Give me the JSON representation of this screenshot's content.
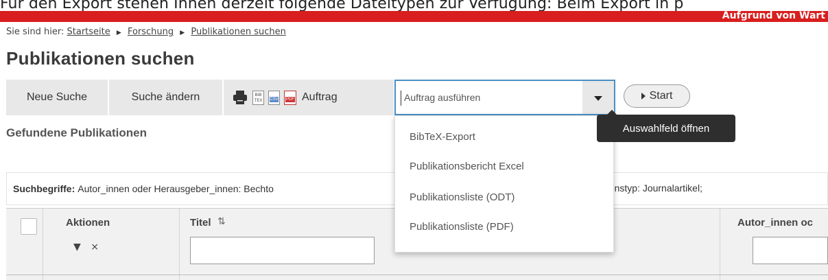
{
  "top_caption": "Für den Export stehen Ihnen derzeit folgende Dateitypen zur Verfügung: Beim Export in p",
  "redbar": {
    "text": "Aufgrund von Wart",
    "color": "#d81e1e"
  },
  "breadcrumb": {
    "prefix": "Sie sind hier:",
    "items": [
      "Startseite",
      "Forschung",
      "Publikationen suchen"
    ]
  },
  "page_title": "Publikationen suchen",
  "toolbar": {
    "new_search": "Neue Suche",
    "edit_search": "Suche ändern",
    "icons": [
      "print-icon",
      "bibtex-icon",
      "csv-icon",
      "pdf-icon"
    ],
    "icon_texts": {
      "bibtex": "BIB TEX",
      "csv": "CSV",
      "pdf": "PDF"
    },
    "auftrag_label": "Auftrag",
    "select_value": "Auftrag ausführen",
    "start_label": "Start"
  },
  "section_heading": "Gefundene Publikationen",
  "search_terms": {
    "label": "Suchbegriffe:",
    "text_left": "Autor_innen oder Herausgeber_innen: Bechto",
    "text_right": "ationstyp: Journalartikel;"
  },
  "table": {
    "headers": {
      "actions": "Aktionen",
      "title": "Titel",
      "author": "Autor_innen oc"
    },
    "filter_icon": "▼",
    "clear_filter_icon": "⨯"
  },
  "dropdown": {
    "options": [
      "BibTeX-Export",
      "Publikationsbericht Excel",
      "Publikationsliste (ODT)",
      "Publikationsliste (PDF)"
    ]
  },
  "tooltip": "Auswahlfeld öffnen",
  "colors": {
    "accent": "#4a8fc4",
    "toolbar_bg": "#e8e8e8",
    "tooltip_bg": "#2e2e2e"
  }
}
